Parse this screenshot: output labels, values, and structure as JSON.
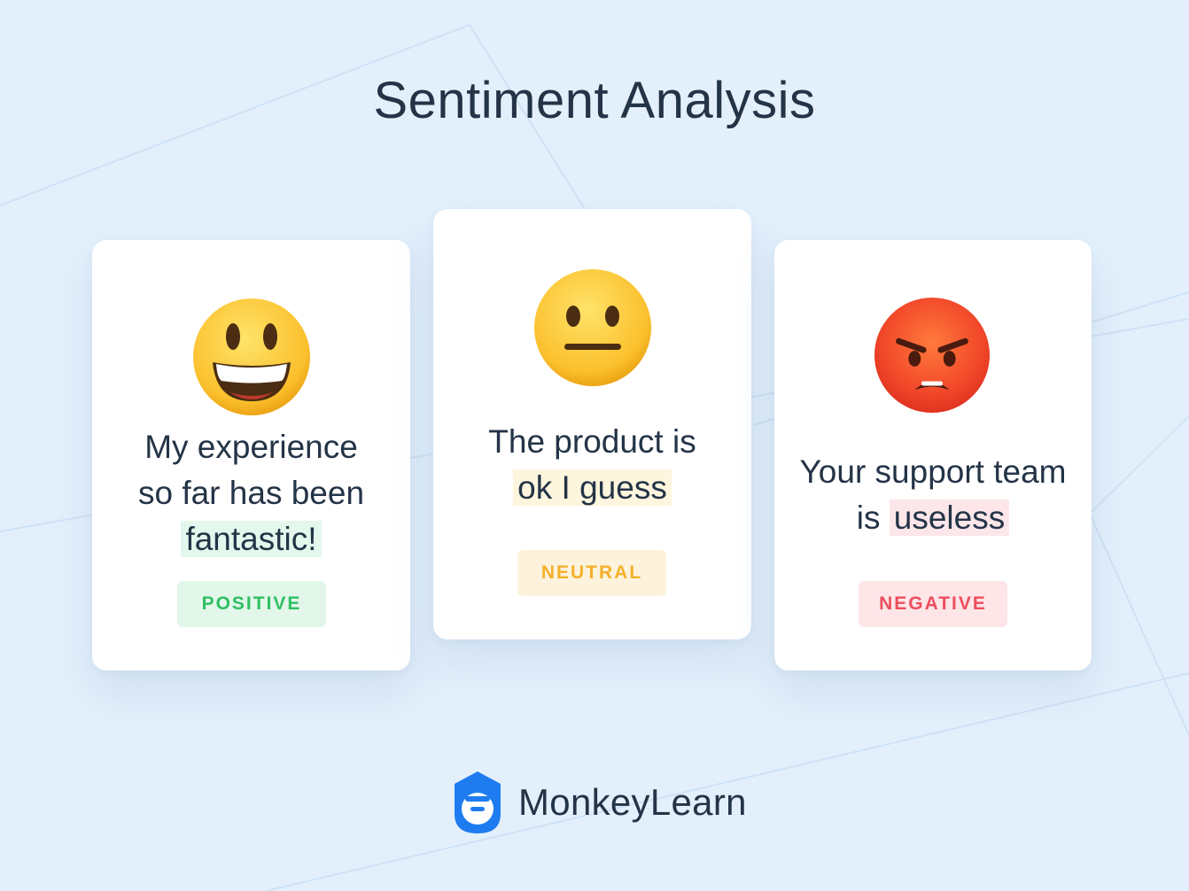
{
  "title": "Sentiment Analysis",
  "cards": [
    {
      "emoji": "grinning-face",
      "text_lines": [
        "My experience",
        "so far has been"
      ],
      "highlight": "fantastic!",
      "label": "POSITIVE",
      "label_color": "#2fbf62",
      "highlight_color": "#e4f7ec"
    },
    {
      "emoji": "neutral-face",
      "text_lines": [
        "The product is"
      ],
      "highlight": "ok I guess",
      "label": "NEUTRAL",
      "label_color": "#f3b02a",
      "highlight_color": "#fdf5dd"
    },
    {
      "emoji": "angry-face",
      "text_lines": [
        "Your support team",
        "is"
      ],
      "highlight": "useless",
      "label": "NEGATIVE",
      "label_color": "#ec4f5e",
      "highlight_color": "#fde6ea"
    }
  ],
  "brand": {
    "name": "MonkeyLearn",
    "logo_color": "#1f7cf0"
  }
}
